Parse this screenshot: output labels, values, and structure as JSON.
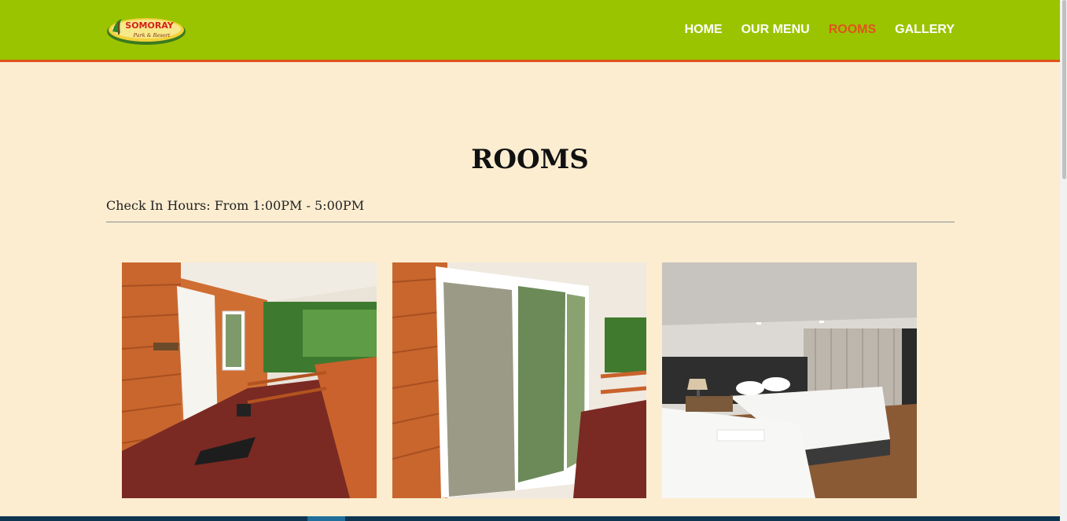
{
  "logo": {
    "line1": "SOMORAY",
    "line2": "Park & Resort"
  },
  "nav": {
    "home": "HOME",
    "menu": "OUR MENU",
    "rooms": "ROOMS",
    "gallery": "GALLERY"
  },
  "page": {
    "title": "ROOMS",
    "checkin": "Check In Hours: From 1:00PM - 5:00PM"
  },
  "photos": [
    "Porch with door and railing",
    "Sliding glass door on porch",
    "Bedroom with two beds"
  ],
  "colors": {
    "header": "#9bc400",
    "accent": "#e0531b",
    "background": "#fcedd1"
  }
}
